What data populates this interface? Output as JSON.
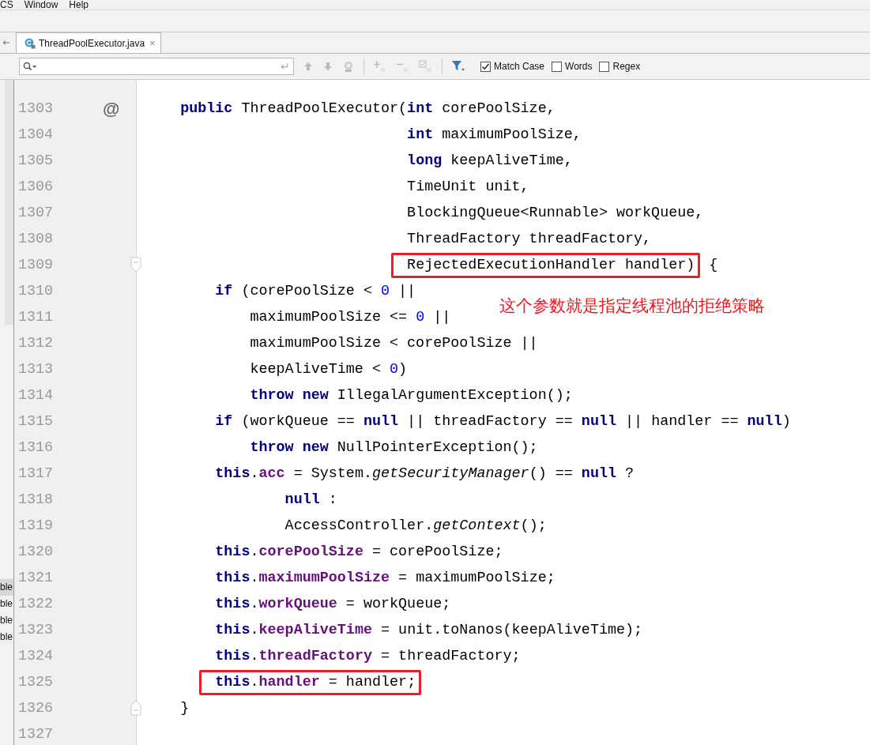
{
  "menu": [
    "CS",
    "Window",
    "Help"
  ],
  "tab": {
    "label": "ThreadPoolExecutor.java",
    "selected": true,
    "close": "×"
  },
  "find_bar": {
    "enter_glyph": "↵",
    "options": [
      {
        "label": "Match Case",
        "checked": true
      },
      {
        "label": "Words",
        "checked": false
      },
      {
        "label": "Regex",
        "checked": false
      }
    ]
  },
  "side_panel": {
    "items": [
      "ble",
      "ble",
      "ble",
      "ble"
    ]
  },
  "note": "这个参数就是指定线程池的拒绝策略",
  "lines": [
    {
      "number": "1303",
      "gutter": "@",
      "code": [
        {
          "kind": "kw",
          "text": "    public"
        },
        {
          "kind": "plain",
          "text": " ThreadPoolExecutor("
        },
        {
          "kind": "kw",
          "text": "int"
        },
        {
          "kind": "plain",
          "text": " corePoolSize,"
        }
      ]
    },
    {
      "number": "1304",
      "code": [
        {
          "kind": "kw",
          "text": "                              int"
        },
        {
          "kind": "plain",
          "text": " maximumPoolSize,"
        }
      ]
    },
    {
      "number": "1305",
      "code": [
        {
          "kind": "kw",
          "text": "                              long"
        },
        {
          "kind": "plain",
          "text": " keepAliveTime,"
        }
      ]
    },
    {
      "number": "1306",
      "code": [
        {
          "kind": "plain",
          "text": "                              TimeUnit unit,"
        }
      ]
    },
    {
      "number": "1307",
      "code": [
        {
          "kind": "plain",
          "text": "                              BlockingQueue<Runnable> workQueue,"
        }
      ]
    },
    {
      "number": "1308",
      "code": [
        {
          "kind": "plain",
          "text": "                              ThreadFactory threadFactory,"
        }
      ]
    },
    {
      "number": "1309",
      "fold_marker": {
        "kind": "start"
      },
      "boxed": [
        {
          "kind": "plain",
          "text": "                              RejectedExecutionHandler handler)"
        }
      ],
      "after": " {"
    },
    {
      "number": "1310",
      "code": [
        {
          "kind": "kw",
          "text": "        if"
        },
        {
          "kind": "plain",
          "text": " (corePoolSize < "
        },
        {
          "kind": "num",
          "text": "0"
        },
        {
          "kind": "plain",
          "text": " ||"
        }
      ]
    },
    {
      "number": "1311",
      "code": [
        {
          "kind": "plain",
          "text": "            maximumPoolSize <= "
        },
        {
          "kind": "num",
          "text": "0"
        },
        {
          "kind": "plain",
          "text": " ||"
        }
      ]
    },
    {
      "number": "1312",
      "code": [
        {
          "kind": "plain",
          "text": "            maximumPoolSize < corePoolSize ||"
        }
      ]
    },
    {
      "number": "1313",
      "code": [
        {
          "kind": "plain",
          "text": "            keepAliveTime < "
        },
        {
          "kind": "num",
          "text": "0"
        },
        {
          "kind": "plain",
          "text": ")"
        }
      ]
    },
    {
      "number": "1314",
      "code": [
        {
          "kind": "kw",
          "text": "            throw"
        },
        {
          "kind": "kw",
          "text": " new"
        },
        {
          "kind": "plain",
          "text": " IllegalArgumentException();"
        }
      ]
    },
    {
      "number": "1315",
      "code": [
        {
          "kind": "kw",
          "text": "        if"
        },
        {
          "kind": "plain",
          "text": " (workQueue == "
        },
        {
          "kind": "kw",
          "text": "null"
        },
        {
          "kind": "plain",
          "text": " || threadFactory == "
        },
        {
          "kind": "kw",
          "text": "null"
        },
        {
          "kind": "plain",
          "text": " || handler == "
        },
        {
          "kind": "kw",
          "text": "null"
        },
        {
          "kind": "plain",
          "text": ")"
        }
      ]
    },
    {
      "number": "1316",
      "code": [
        {
          "kind": "kw",
          "text": "            throw"
        },
        {
          "kind": "kw",
          "text": " new"
        },
        {
          "kind": "plain",
          "text": " NullPointerException();"
        }
      ]
    },
    {
      "number": "1317",
      "code": [
        {
          "kind": "kw",
          "text": "        this"
        },
        {
          "kind": "plain",
          "text": "."
        },
        {
          "kind": "field",
          "text": "acc"
        },
        {
          "kind": "plain",
          "text": " = System."
        },
        {
          "kind": "method",
          "text": "getSecurityManager"
        },
        {
          "kind": "plain",
          "text": "() == "
        },
        {
          "kind": "kw",
          "text": "null"
        },
        {
          "kind": "plain",
          "text": " ?"
        }
      ]
    },
    {
      "number": "1318",
      "code": [
        {
          "kind": "kw",
          "text": "                null"
        },
        {
          "kind": "plain",
          "text": " :"
        }
      ]
    },
    {
      "number": "1319",
      "code": [
        {
          "kind": "plain",
          "text": "                AccessController."
        },
        {
          "kind": "method",
          "text": "getContext"
        },
        {
          "kind": "plain",
          "text": "();"
        }
      ]
    },
    {
      "number": "1320",
      "code": [
        {
          "kind": "kw",
          "text": "        this"
        },
        {
          "kind": "plain",
          "text": "."
        },
        {
          "kind": "field",
          "text": "corePoolSize"
        },
        {
          "kind": "plain",
          "text": " = corePoolSize;"
        }
      ]
    },
    {
      "number": "1321",
      "code": [
        {
          "kind": "kw",
          "text": "        this"
        },
        {
          "kind": "plain",
          "text": "."
        },
        {
          "kind": "field",
          "text": "maximumPoolSize"
        },
        {
          "kind": "plain",
          "text": " = maximumPoolSize;"
        }
      ]
    },
    {
      "number": "1322",
      "code": [
        {
          "kind": "kw",
          "text": "        this"
        },
        {
          "kind": "plain",
          "text": "."
        },
        {
          "kind": "field",
          "text": "workQueue"
        },
        {
          "kind": "plain",
          "text": " = workQueue;"
        }
      ]
    },
    {
      "number": "1323",
      "code": [
        {
          "kind": "kw",
          "text": "        this"
        },
        {
          "kind": "plain",
          "text": "."
        },
        {
          "kind": "field",
          "text": "keepAliveTime"
        },
        {
          "kind": "plain",
          "text": " = unit.toNanos(keepAliveTime);"
        }
      ]
    },
    {
      "number": "1324",
      "code": [
        {
          "kind": "kw",
          "text": "        this"
        },
        {
          "kind": "plain",
          "text": "."
        },
        {
          "kind": "field",
          "text": "threadFactory"
        },
        {
          "kind": "plain",
          "text": " = threadFactory;"
        }
      ]
    },
    {
      "number": "1325",
      "boxed": [
        {
          "kind": "kw",
          "text": "        this"
        },
        {
          "kind": "plain",
          "text": "."
        },
        {
          "kind": "field",
          "text": "handler"
        },
        {
          "kind": "plain",
          "text": " = handler;"
        }
      ]
    },
    {
      "number": "1326",
      "fold_marker": {
        "kind": "end"
      },
      "code": [
        {
          "kind": "plain",
          "text": "    }"
        }
      ]
    },
    {
      "number": "1327"
    }
  ]
}
